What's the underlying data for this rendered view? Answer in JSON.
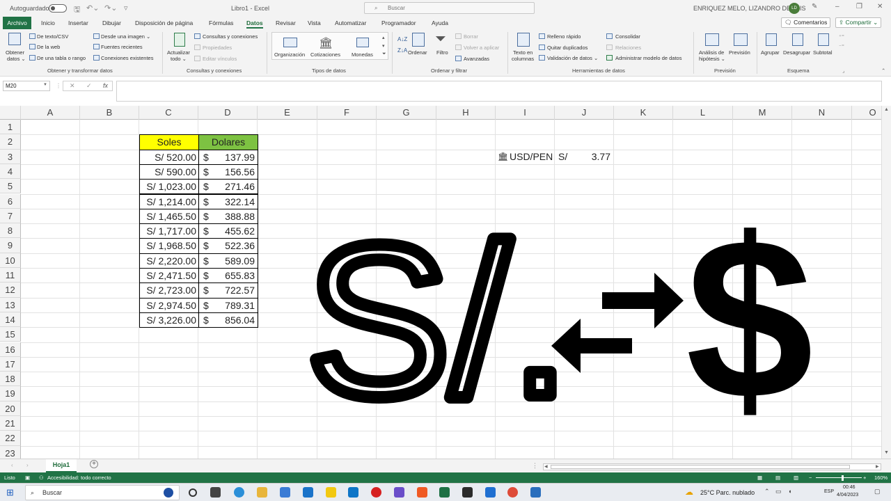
{
  "titlebar": {
    "autosave_label": "Autoguardado",
    "doc_title": "Libro1 - Excel",
    "search_placeholder": "Buscar",
    "user_name": "ENRIQUEZ MELO, LIZANDRO DENNIS",
    "user_initials": "LD"
  },
  "tabs": {
    "file": "Archivo",
    "items": [
      "Inicio",
      "Insertar",
      "Dibujar",
      "Disposición de página",
      "Fórmulas",
      "Datos",
      "Revisar",
      "Vista",
      "Automatizar",
      "Programador",
      "Ayuda"
    ],
    "active": "Datos",
    "comments_label": "Comentarios",
    "share_label": "Compartir"
  },
  "ribbon": {
    "get_data": {
      "obtener_1": "Obtener",
      "obtener_2": "datos ⌄",
      "texto_csv": "De texto/CSV",
      "web": "De la web",
      "tabla_rango": "De una tabla o rango",
      "desde_imagen": "Desde una imagen ⌄",
      "fuentes": "Fuentes recientes",
      "conexiones": "Conexiones existentes",
      "group": "Obtener y transformar datos"
    },
    "queries": {
      "actualizar_1": "Actualizar",
      "actualizar_2": "todo ⌄",
      "consultas": "Consultas y conexiones",
      "propiedades": "Propiedades",
      "editar": "Editar vínculos",
      "group": "Consultas y conexiones"
    },
    "datatypes": {
      "organizacion": "Organización",
      "cotizaciones": "Cotizaciones",
      "monedas": "Monedas",
      "group": "Tipos de datos"
    },
    "sortfilter": {
      "ordenar": "Ordenar",
      "filtro": "Filtro",
      "borrar": "Borrar",
      "volver": "Volver a aplicar",
      "avanzadas": "Avanzadas",
      "group": "Ordenar y filtrar"
    },
    "tools": {
      "texto_1": "Texto en",
      "texto_2": "columnas",
      "relleno": "Relleno rápido",
      "quitar": "Quitar duplicados",
      "validacion": "Validación de datos ⌄",
      "consolidar": "Consolidar",
      "relaciones": "Relaciones",
      "administrar": "Administrar modelo de datos",
      "group": "Herramientas de datos"
    },
    "forecast": {
      "analisis_1": "Análisis de",
      "analisis_2": "hipótesis ⌄",
      "prevision": "Previsión",
      "group": "Previsión"
    },
    "outline": {
      "agrupar": "Agrupar",
      "desagrupar": "Desagrupar",
      "subtotal": "Subtotal",
      "group": "Esquema"
    }
  },
  "formula_bar": {
    "name_box": "M20",
    "formula": ""
  },
  "grid": {
    "columns": [
      "A",
      "B",
      "C",
      "D",
      "E",
      "F",
      "G",
      "H",
      "I",
      "J",
      "K",
      "L",
      "M",
      "N",
      "O"
    ],
    "rows": [
      "1",
      "2",
      "3",
      "4",
      "5",
      "6",
      "7",
      "8",
      "9",
      "10",
      "11",
      "12",
      "13",
      "14",
      "15",
      "16",
      "17",
      "18",
      "19",
      "20",
      "21",
      "22",
      "23"
    ],
    "table_headers": {
      "soles": "Soles",
      "dolares": "Dolares"
    },
    "dollar_sign": "$",
    "soles": [
      "S/ 520.00",
      "S/ 590.00",
      "S/ 1,023.00",
      "S/ 1,214.00",
      "S/ 1,465.50",
      "S/ 1,717.00",
      "S/ 1,968.50",
      "S/ 2,220.00",
      "S/ 2,471.50",
      "S/ 2,723.00",
      "S/ 2,974.50",
      "S/ 3,226.00"
    ],
    "dolares": [
      "137.99",
      "156.56",
      "271.46",
      "322.14",
      "388.88",
      "455.62",
      "522.36",
      "589.09",
      "655.83",
      "722.57",
      "789.31",
      "856.04"
    ],
    "rate_label": "USD/PEN",
    "rate_currency": "S/",
    "rate_value": "3.77",
    "header_colors": {
      "soles": "#ffff00",
      "dolares": "#7dc242"
    }
  },
  "graphic": {
    "soles_symbol": "S/.",
    "dollar_symbol": "$"
  },
  "sheets": {
    "active": "Hoja1"
  },
  "status": {
    "ready": "Listo",
    "accessibility": "Accesibilidad: todo correcto",
    "zoom": "160%"
  },
  "taskbar": {
    "search": "Buscar",
    "weather": "25°C  Parc. nublado",
    "lang": "ESP",
    "time": "00:46",
    "date": "4/04/2023"
  }
}
